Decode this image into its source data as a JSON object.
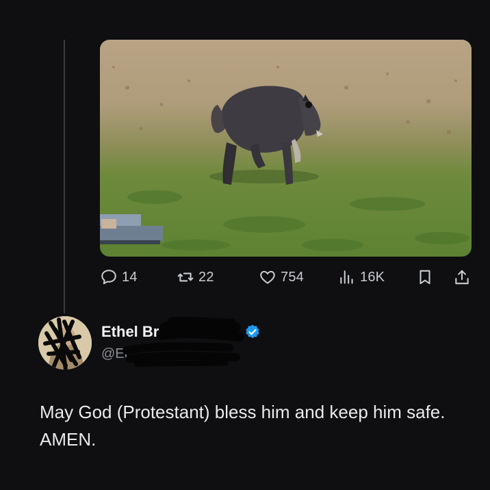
{
  "post": {
    "media": {
      "alt_icon": "raccoon-photo"
    },
    "actions": {
      "replies": "14",
      "reposts": "22",
      "likes": "754",
      "views": "16K"
    }
  },
  "reply": {
    "author_name": "Ethel Br",
    "author_handle": "@Et",
    "verified": true,
    "text": "May God (Protestant) bless him and keep him safe. AMEN."
  },
  "colors": {
    "background": "#0f0f11",
    "icon": "#c9ccd0",
    "verified": "#1d9bf0",
    "handle": "#8b8f95"
  }
}
